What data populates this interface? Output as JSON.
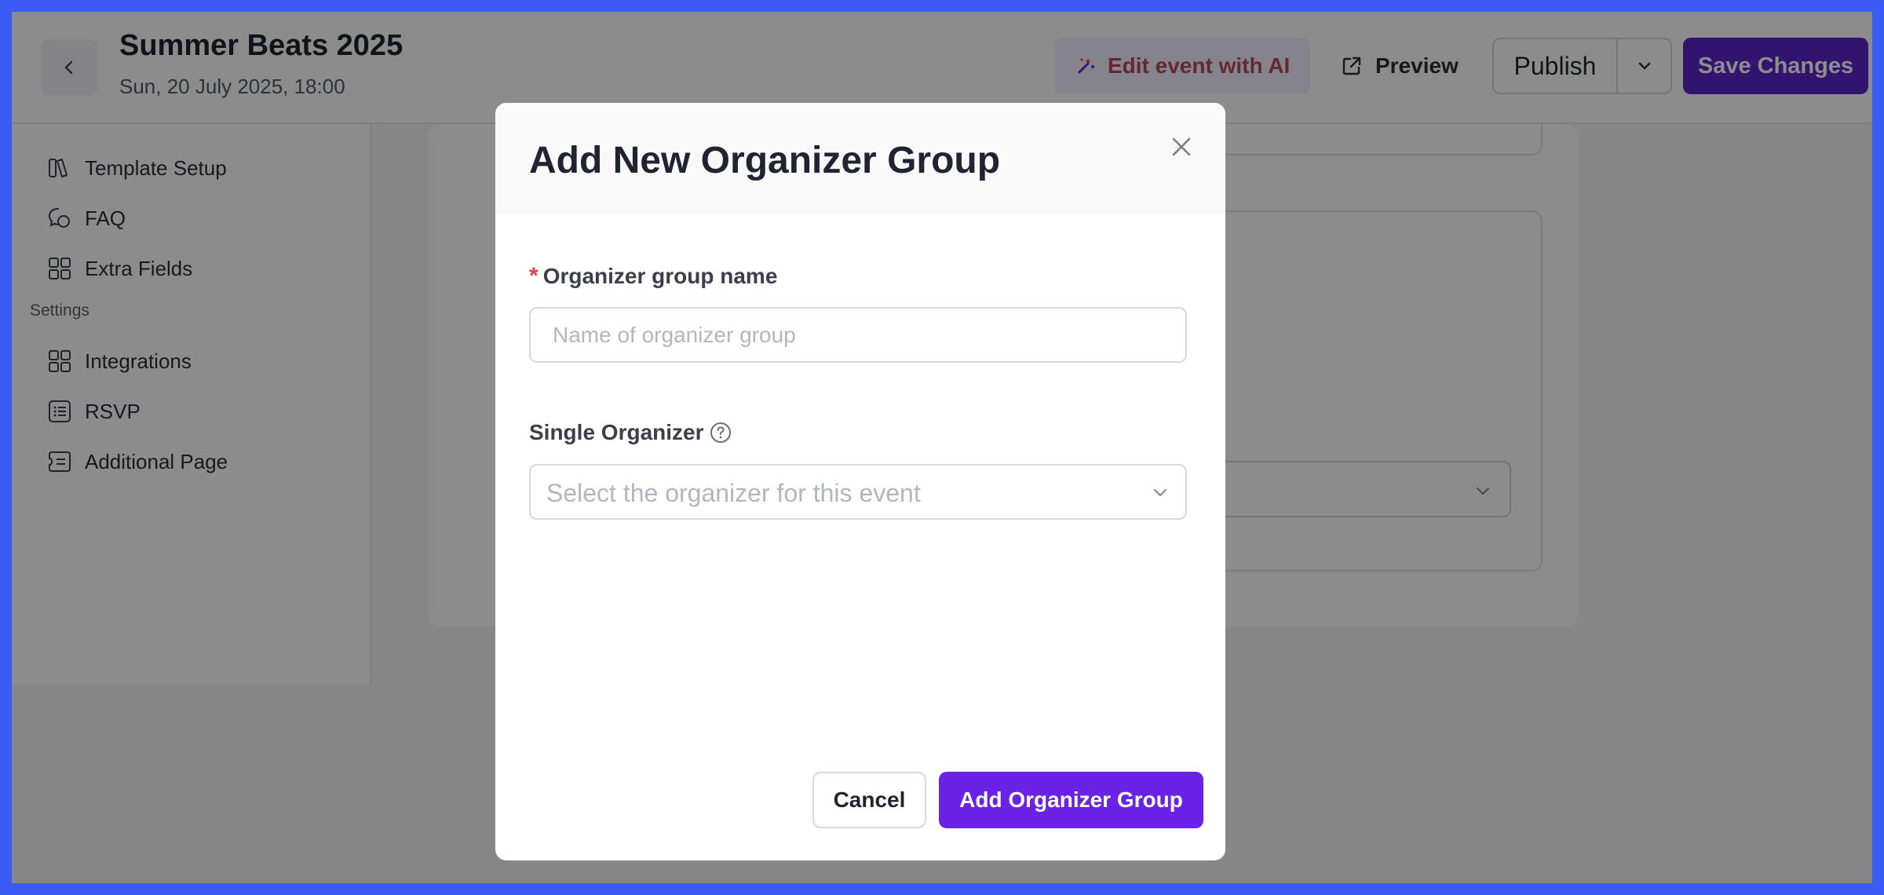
{
  "header": {
    "event_title": "Summer Beats 2025",
    "event_date": "Sun, 20 July 2025, 18:00",
    "ai_button": "Edit event with AI",
    "preview_button": "Preview",
    "publish_button": "Publish",
    "save_button": "Save Changes"
  },
  "sidebar": {
    "items": [
      {
        "label": "Template Setup",
        "icon": "template-icon"
      },
      {
        "label": "FAQ",
        "icon": "chat-icon"
      },
      {
        "label": "Extra Fields",
        "icon": "grid-icon"
      }
    ],
    "settings_heading": "Settings",
    "settings_items": [
      {
        "label": "Integrations",
        "icon": "grid-icon"
      },
      {
        "label": "RSVP",
        "icon": "list-icon"
      },
      {
        "label": "Additional Page",
        "icon": "page-icon"
      }
    ]
  },
  "modal": {
    "title": "Add New Organizer Group",
    "group_name_label": "Organizer group name",
    "required_mark": "*",
    "group_name_placeholder": "Name of organizer group",
    "group_name_value": "",
    "single_organizer_label": "Single Organizer",
    "single_organizer_placeholder": "Select the organizer for this event",
    "cancel_button": "Cancel",
    "add_button": "Add Organizer Group"
  },
  "colors": {
    "brand_primary": "#5b23c9",
    "modal_primary": "#6a22e6",
    "required": "#e0424a",
    "frame_border": "#3b5bf5"
  }
}
